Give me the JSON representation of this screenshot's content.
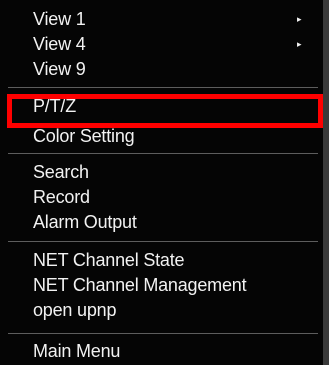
{
  "menu": {
    "items": [
      {
        "label": "View 1",
        "submenu": true
      },
      {
        "label": "View 4",
        "submenu": true
      },
      {
        "label": "View 9",
        "submenu": false
      },
      {
        "label": "P/T/Z",
        "submenu": false
      },
      {
        "label": "Color Setting",
        "submenu": false
      },
      {
        "label": "Search",
        "submenu": false
      },
      {
        "label": "Record",
        "submenu": false
      },
      {
        "label": "Alarm Output",
        "submenu": false
      },
      {
        "label": "NET Channel State",
        "submenu": false
      },
      {
        "label": "NET Channel Management",
        "submenu": false
      },
      {
        "label": "open upnp",
        "submenu": false
      },
      {
        "label": "Main Menu",
        "submenu": false
      }
    ],
    "submenu_arrow": "▸",
    "highlight_color": "#ff0000"
  }
}
